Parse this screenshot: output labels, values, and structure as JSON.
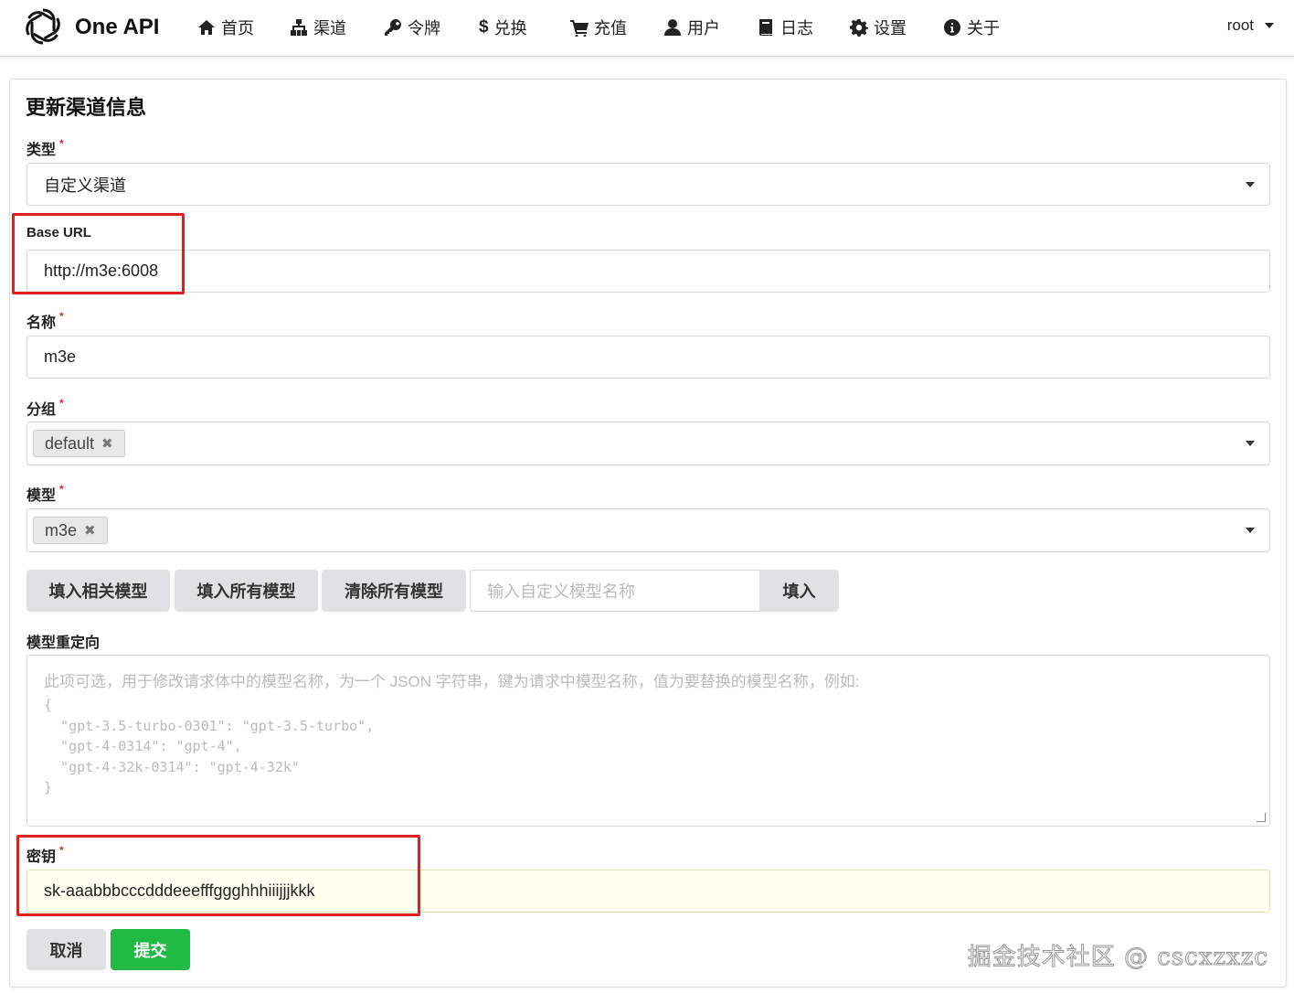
{
  "app": {
    "name": "One API"
  },
  "nav": {
    "items": [
      {
        "label": "首页",
        "icon": "home-icon"
      },
      {
        "label": "渠道",
        "icon": "sitemap-icon"
      },
      {
        "label": "令牌",
        "icon": "key-icon"
      },
      {
        "label": "兑换",
        "icon": "dollar-icon"
      },
      {
        "label": "充值",
        "icon": "cart-icon"
      },
      {
        "label": "用户",
        "icon": "user-icon"
      },
      {
        "label": "日志",
        "icon": "book-icon"
      },
      {
        "label": "设置",
        "icon": "gear-icon"
      },
      {
        "label": "关于",
        "icon": "info-icon"
      }
    ],
    "user": "root"
  },
  "form": {
    "title": "更新渠道信息",
    "required_mark": "*",
    "type": {
      "label": "类型",
      "value": "自定义渠道"
    },
    "base_url": {
      "label": "Base URL",
      "value": "http://m3e:6008"
    },
    "name": {
      "label": "名称",
      "value": "m3e"
    },
    "group": {
      "label": "分组",
      "chip": "default",
      "chip_remove": "✖"
    },
    "models": {
      "label": "模型",
      "chip": "m3e",
      "chip_remove": "✖",
      "buttons": {
        "fill_related": "填入相关模型",
        "fill_all": "填入所有模型",
        "clear_all": "清除所有模型"
      },
      "custom_placeholder": "输入自定义模型名称",
      "fill_button": "填入"
    },
    "mapping": {
      "label": "模型重定向",
      "placeholder_line1": "此项可选，用于修改请求体中的模型名称，为一个 JSON 字符串，键为请求中模型名称，值为要替换的模型名称，例如:",
      "placeholder_code": "{\n  \"gpt-3.5-turbo-0301\": \"gpt-3.5-turbo\",\n  \"gpt-4-0314\": \"gpt-4\",\n  \"gpt-4-32k-0314\": \"gpt-4-32k\"\n}"
    },
    "key": {
      "label": "密钥",
      "value": "sk-aaabbbcccdddeeefffggghhhiiijjjkkk"
    },
    "cancel": "取消",
    "submit": "提交"
  },
  "watermark": "掘金技术社区 @ cscxzxzc",
  "colors": {
    "submit": "#21ba45",
    "highlight": "#e0201e",
    "key_bg": "#fffff0"
  }
}
